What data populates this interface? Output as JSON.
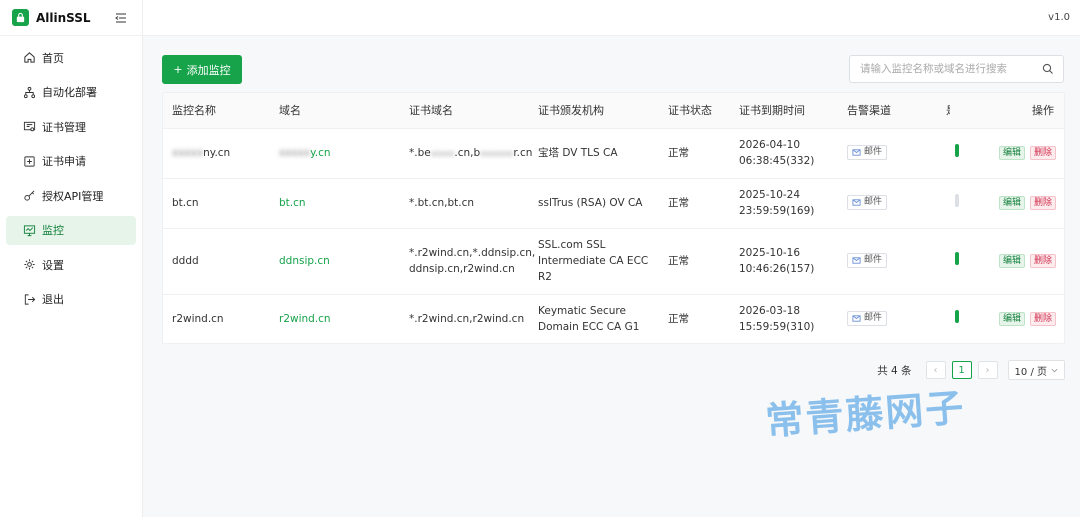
{
  "brand": {
    "name": "AllinSSL"
  },
  "header": {
    "version": "v1.0"
  },
  "sidebar": {
    "items": [
      {
        "label": "首页",
        "icon": "home-icon"
      },
      {
        "label": "自动化部署",
        "icon": "workflow-icon"
      },
      {
        "label": "证书管理",
        "icon": "certificate-icon"
      },
      {
        "label": "证书申请",
        "icon": "plus-square-icon"
      },
      {
        "label": "授权API管理",
        "icon": "key-icon"
      },
      {
        "label": "监控",
        "icon": "monitor-icon",
        "active": true
      },
      {
        "label": "设置",
        "icon": "gear-icon"
      },
      {
        "label": "退出",
        "icon": "logout-icon"
      }
    ]
  },
  "toolbar": {
    "add_label": "添加监控",
    "search_placeholder": "请输入监控名称或域名进行搜索"
  },
  "table": {
    "columns": [
      "监控名称",
      "域名",
      "证书域名",
      "证书颁发机构",
      "证书状态",
      "证书到期时间",
      "告警渠道",
      "是",
      "操作"
    ],
    "rows": [
      {
        "name": "ny.cn",
        "name_blur": "xxxxx",
        "domain": "y.cn",
        "domain_blur": "xxxxx",
        "cert_domain_a": "*.be",
        "cert_domain_blur1": "xxxxx",
        "cert_domain_b": ".cn,b",
        "cert_domain_blur2": "xxxxxxx",
        "cert_domain_c": "r.cn",
        "issuer": "宝塔 DV TLS CA",
        "status": "正常",
        "expiry_date": "2026-04-10",
        "expiry_time": "06:38:45(332)",
        "alert": "邮件",
        "enabled": true
      },
      {
        "name": "bt.cn",
        "domain": "bt.cn",
        "cert_domain": "*.bt.cn,bt.cn",
        "issuer": "sslTrus (RSA) OV CA",
        "status": "正常",
        "expiry_date": "2025-10-24",
        "expiry_time": "23:59:59(169)",
        "alert": "邮件",
        "enabled": false
      },
      {
        "name": "dddd",
        "domain": "ddnsip.cn",
        "cert_domain_l1": "*.r2wind.cn,*.ddnsip.cn,",
        "cert_domain_l2": "ddnsip.cn,r2wind.cn",
        "issuer_l1": "SSL.com SSL",
        "issuer_l2": "Intermediate CA ECC",
        "issuer_l3": "R2",
        "status": "正常",
        "expiry_date": "2025-10-16",
        "expiry_time": "10:46:26(157)",
        "alert": "邮件",
        "enabled": true
      },
      {
        "name": "r2wind.cn",
        "domain": "r2wind.cn",
        "cert_domain": "*.r2wind.cn,r2wind.cn",
        "issuer_l1": "Keymatic Secure",
        "issuer_l2": "Domain ECC CA G1",
        "status": "正常",
        "expiry_date": "2026-03-18",
        "expiry_time": "15:59:59(310)",
        "alert": "邮件",
        "enabled": true
      }
    ],
    "edit_label": "编辑",
    "delete_label": "删除"
  },
  "pagination": {
    "total": "共 4 条",
    "current": "1",
    "page_size": "10 / 页",
    "prev": "‹",
    "next": "›"
  },
  "watermark": "常青藤网子",
  "colors": {
    "accent": "#16a34a",
    "danger": "#d03050",
    "watermark": "#79b7ea"
  }
}
